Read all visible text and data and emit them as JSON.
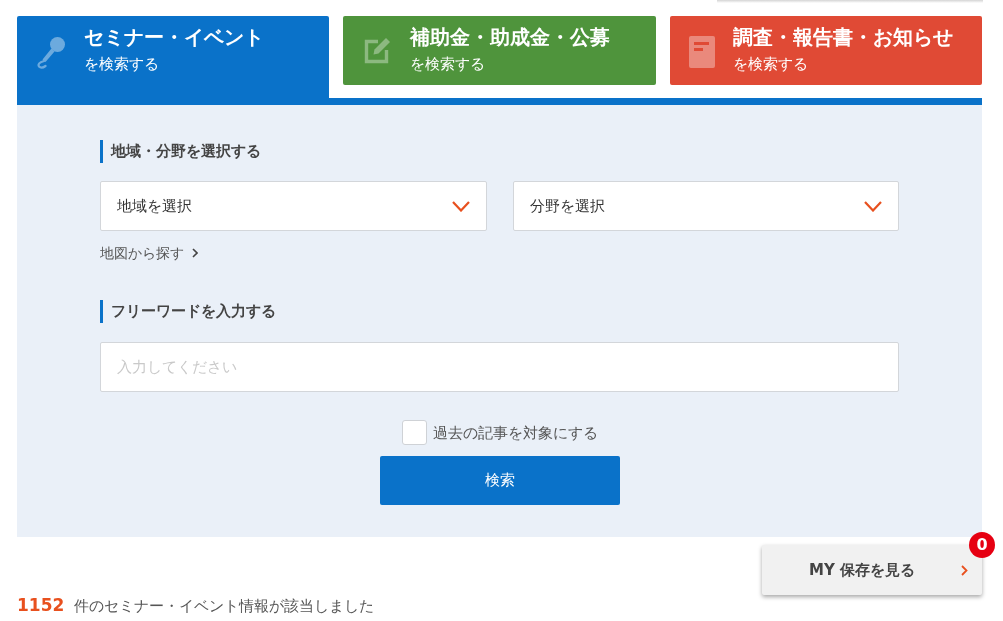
{
  "tabs": [
    {
      "kind": "seminar",
      "title": "セミナー・イベント",
      "subtitle": "を検索する",
      "color": "#0a72c9",
      "selected": true
    },
    {
      "kind": "grant",
      "title": "補助金・助成金・公募",
      "subtitle": "を検索する",
      "color": "#4f943c",
      "selected": false
    },
    {
      "kind": "report",
      "title": "調査・報告書・お知らせ",
      "subtitle": "を検索する",
      "color": "#e04a35",
      "selected": false
    }
  ],
  "search_panel": {
    "area_section": {
      "heading": "地域・分野を選択する",
      "selects": [
        {
          "value": "地域を選択"
        },
        {
          "value": "分野を選択"
        }
      ],
      "map_link": "地図から探す"
    },
    "keyword_section": {
      "heading": "フリーワードを入力する",
      "input": {
        "placeholder": "入力してください"
      }
    },
    "past_articles": {
      "label": "過去の記事を対象にする",
      "checked": false
    },
    "search_button": "検索"
  },
  "saved_button": {
    "label": "MY 保存を見る",
    "badge": "0"
  },
  "results": {
    "count": "1152",
    "text": "件のセミナー・イベント情報が該当しました"
  }
}
